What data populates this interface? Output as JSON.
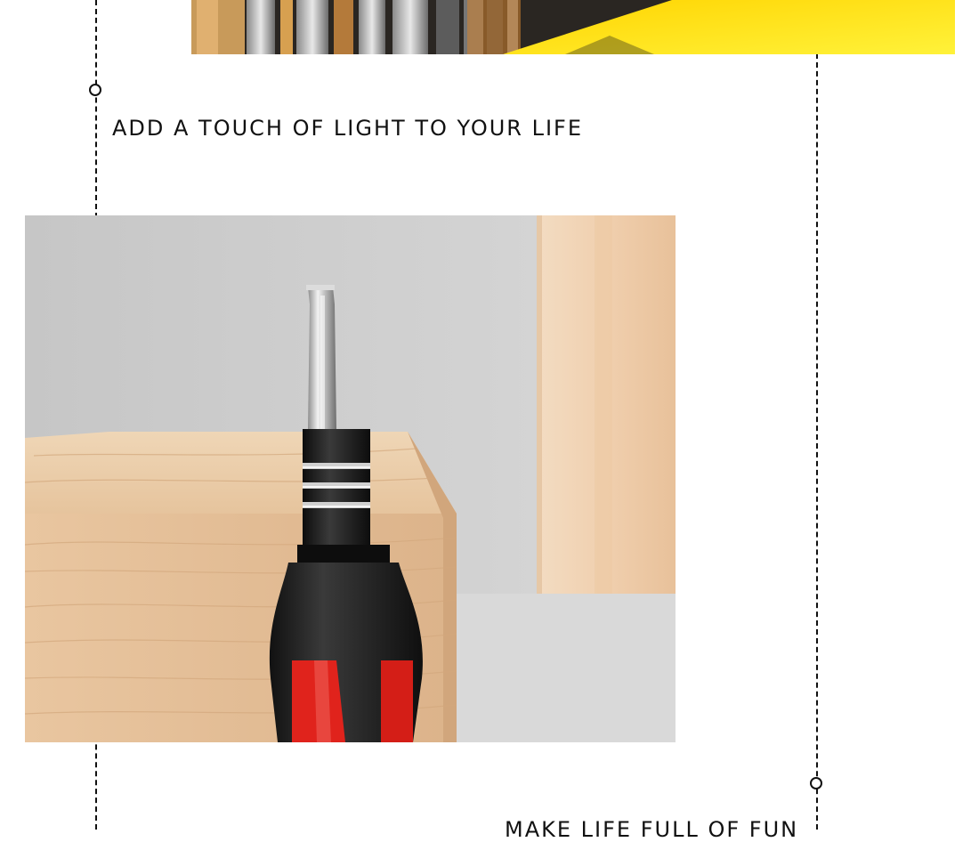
{
  "sections": {
    "heading_top": "ADD A TOUCH OF LIGHT TO YOUR LIFE",
    "heading_bottom": "MAKE LIFE FULL OF FUN"
  },
  "photos": {
    "top_photo": {
      "icon": "tool-set-photo"
    },
    "main_photo": {
      "icon": "screwdriver-photo"
    }
  },
  "colors": {
    "accent_yellow": "#ffe51a",
    "handle_red": "#e0231c",
    "handle_black": "#1a1a1a",
    "wood": "#e8c9a4"
  }
}
